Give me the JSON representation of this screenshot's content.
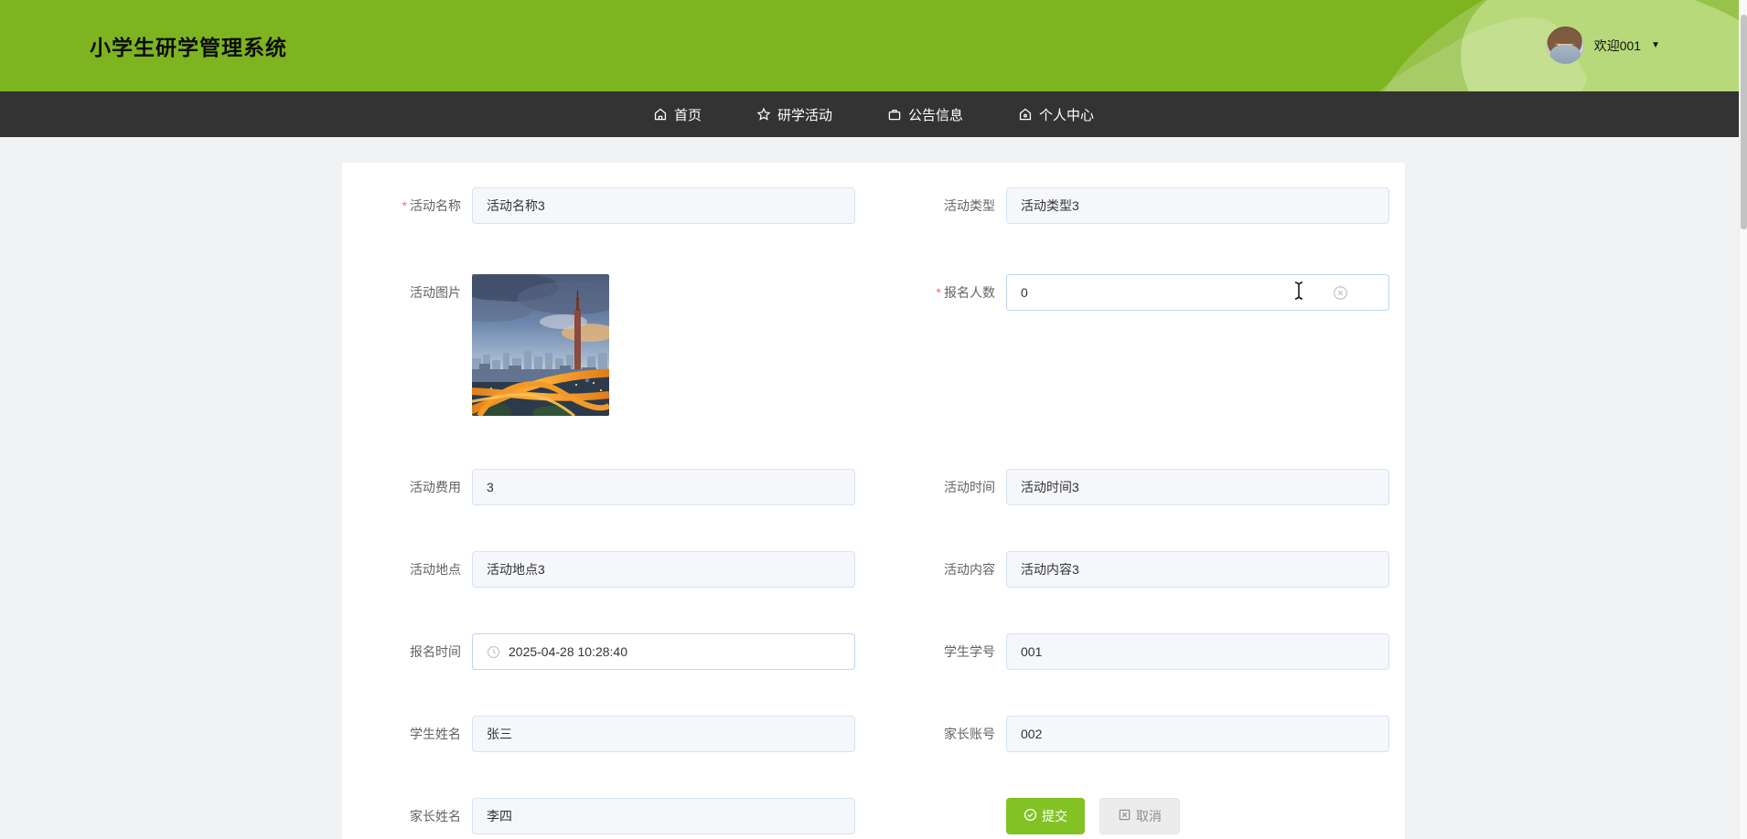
{
  "header": {
    "title": "小学生研学管理系统",
    "welcome": "欢迎001"
  },
  "nav": {
    "items": [
      {
        "label": "首页",
        "icon": "home-icon"
      },
      {
        "label": "研学活动",
        "icon": "star-icon"
      },
      {
        "label": "公告信息",
        "icon": "briefcase-icon"
      },
      {
        "label": "个人中心",
        "icon": "home-user-icon"
      }
    ]
  },
  "form": {
    "required_marker": "*",
    "fields": {
      "activity_name": {
        "label": "活动名称",
        "required": true,
        "value": "活动名称3"
      },
      "activity_type": {
        "label": "活动类型",
        "required": false,
        "value": "活动类型3"
      },
      "activity_image": {
        "label": "活动图片",
        "required": false,
        "value": "城市立交桥夜景图片"
      },
      "signup_count": {
        "label": "报名人数",
        "required": true,
        "value": "0"
      },
      "activity_fee": {
        "label": "活动费用",
        "required": false,
        "value": "3"
      },
      "activity_time": {
        "label": "活动时间",
        "required": false,
        "value": "活动时间3"
      },
      "activity_place": {
        "label": "活动地点",
        "required": false,
        "value": "活动地点3"
      },
      "activity_content": {
        "label": "活动内容",
        "required": false,
        "value": "活动内容3"
      },
      "signup_time": {
        "label": "报名时间",
        "required": false,
        "value": "2025-04-28 10:28:40"
      },
      "student_id": {
        "label": "学生学号",
        "required": false,
        "value": "001"
      },
      "student_name": {
        "label": "学生姓名",
        "required": false,
        "value": "张三"
      },
      "parent_account": {
        "label": "家长账号",
        "required": false,
        "value": "002"
      },
      "parent_name": {
        "label": "家长姓名",
        "required": false,
        "value": "李四"
      }
    },
    "buttons": {
      "submit": "提交",
      "cancel": "取消"
    }
  },
  "colors": {
    "header_green": "#7db41f",
    "nav_dark": "#333333",
    "button_green": "#83c224",
    "required_red": "#f56c6c",
    "input_disabled_bg": "#f5f7fa"
  }
}
